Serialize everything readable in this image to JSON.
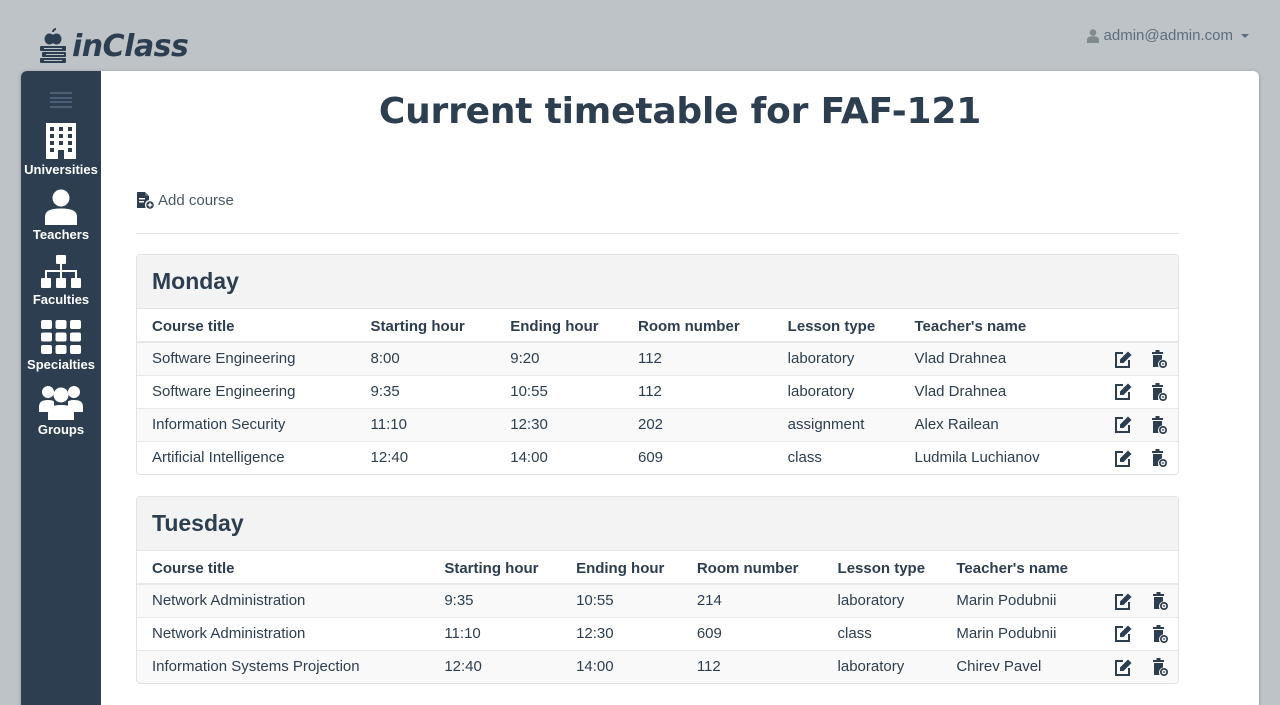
{
  "app": {
    "logo_text": "inClass"
  },
  "user": {
    "email": "admin@admin.com"
  },
  "sidebar": {
    "items": [
      {
        "label": "Universities",
        "icon": "building-icon"
      },
      {
        "label": "Teachers",
        "icon": "person-icon"
      },
      {
        "label": "Faculties",
        "icon": "sitemap-icon"
      },
      {
        "label": "Specialties",
        "icon": "grid-icon"
      },
      {
        "label": "Groups",
        "icon": "group-icon"
      }
    ]
  },
  "page": {
    "title": "Current timetable for FAF-121",
    "add_course_label": "Add course"
  },
  "columns": [
    "Course title",
    "Starting hour",
    "Ending hour",
    "Room number",
    "Lesson type",
    "Teacher's name"
  ],
  "days": [
    {
      "name": "Monday",
      "rows": [
        [
          "Software Engineering",
          "8:00",
          "9:20",
          "112",
          "laboratory",
          "Vlad Drahnea"
        ],
        [
          "Software Engineering",
          "9:35",
          "10:55",
          "112",
          "laboratory",
          "Vlad Drahnea"
        ],
        [
          "Information Security",
          "11:10",
          "12:30",
          "202",
          "assignment",
          "Alex Railean"
        ],
        [
          "Artificial Intelligence",
          "12:40",
          "14:00",
          "609",
          "class",
          "Ludmila Luchianov"
        ]
      ]
    },
    {
      "name": "Tuesday",
      "rows": [
        [
          "Network Administration",
          "9:35",
          "10:55",
          "214",
          "laboratory",
          "Marin Podubnii"
        ],
        [
          "Network Administration",
          "11:10",
          "12:30",
          "609",
          "class",
          "Marin Podubnii"
        ],
        [
          "Information Systems Projection",
          "12:40",
          "14:00",
          "112",
          "laboratory",
          "Chirev Pavel"
        ]
      ]
    }
  ]
}
